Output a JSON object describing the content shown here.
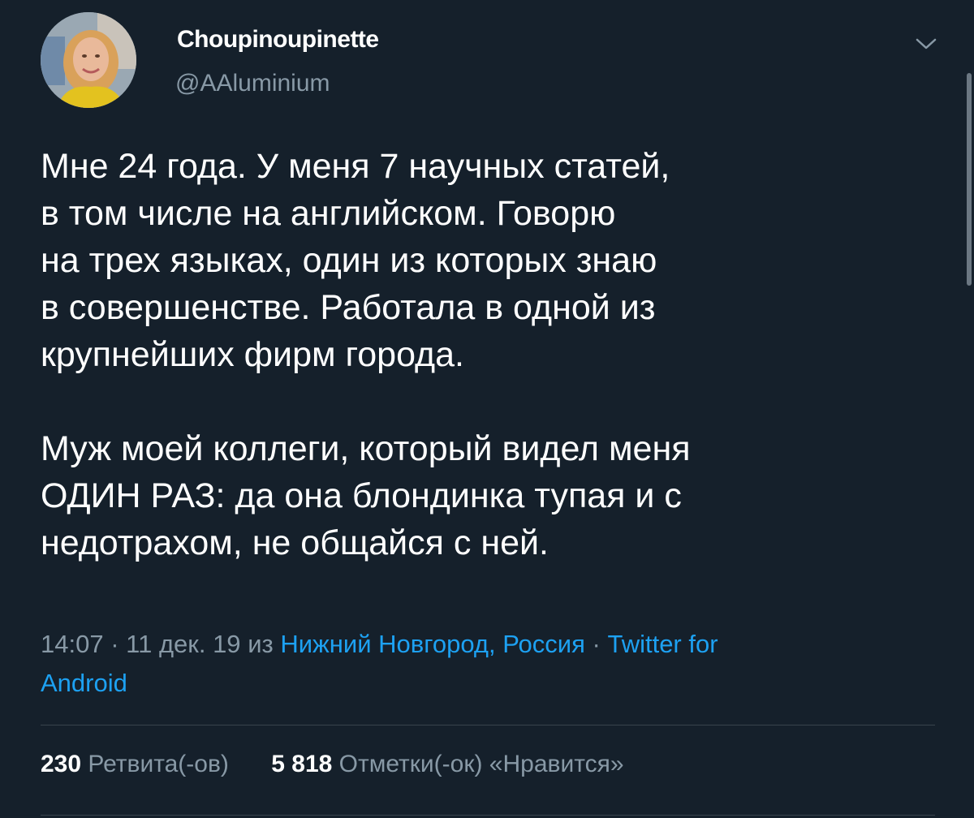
{
  "tweet": {
    "author": {
      "display_name": "Choupinoupinette",
      "handle": "@AAluminium"
    },
    "body_lines": [
      "Мне 24 года. У меня 7 научных статей,",
      "в том числе на английском. Говорю",
      "на трех языках, один из которых знаю",
      "в совершенстве. Работала в одной из",
      "крупнейших фирм города."
    ],
    "body_lines_2": [
      "Муж моей коллеги, который видел меня",
      "ОДИН РАЗ: да она блондинка тупая и с",
      "недотрахом, не общайся с ней."
    ],
    "meta": {
      "time": "14:07",
      "separator": "·",
      "date": "11 дек. 19",
      "from": "из",
      "location": "Нижний Новгород, Россия",
      "source_part1": "Twitter for",
      "source_part2": "Android"
    },
    "stats": {
      "retweets_count": "230",
      "retweets_label": "Ретвита(-ов)",
      "likes_count": "5 818",
      "likes_label": "Отметки(-ок) «Нравится»"
    }
  },
  "icons": {
    "caret": "chevron-down-icon"
  },
  "colors": {
    "background": "#15202b",
    "text_primary": "#ffffff",
    "text_secondary": "#8899a6",
    "link": "#1da1f2",
    "divider": "#38444d"
  }
}
